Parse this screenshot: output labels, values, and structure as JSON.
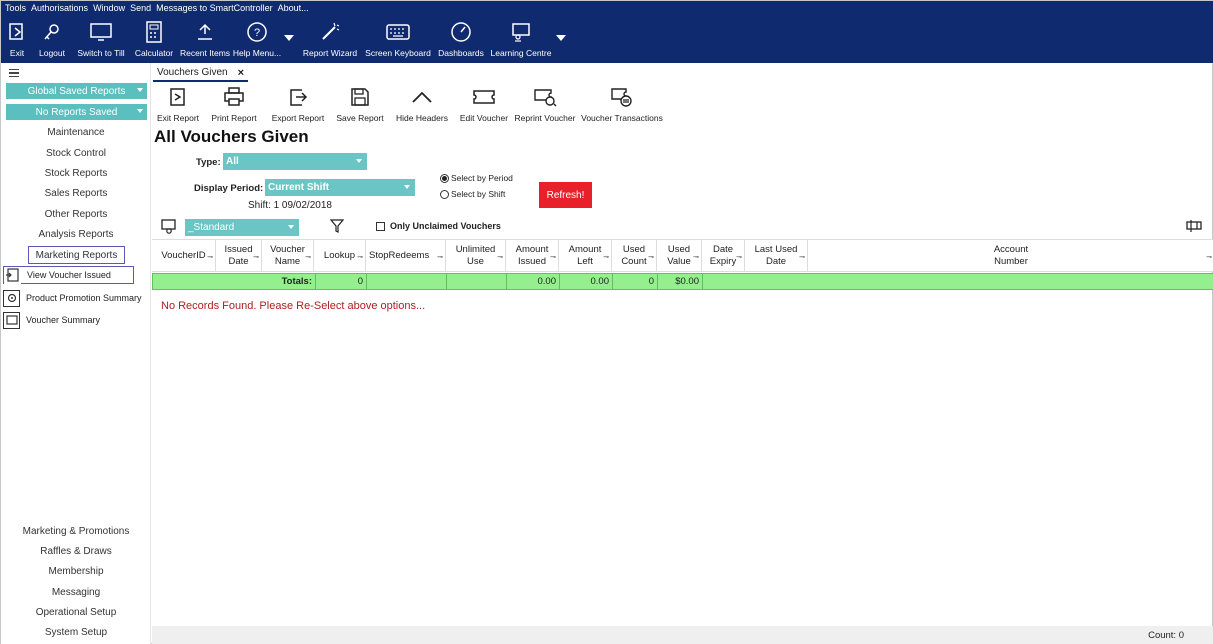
{
  "menu": [
    "Tools",
    "Authorisations",
    "Window",
    "Send",
    "Messages to SmartController",
    "About..."
  ],
  "toolbar": {
    "items": [
      {
        "label": "Exit",
        "icon": "exit-icon"
      },
      {
        "label": "Logout",
        "icon": "key-icon"
      },
      {
        "label": "Switch to Till",
        "icon": "monitor-icon"
      },
      {
        "label": "Calculator",
        "icon": "calculator-icon"
      },
      {
        "label": "Recent Items",
        "icon": "recent-items-icon"
      },
      {
        "label": "Help Menu...",
        "icon": "help-icon"
      },
      {
        "label": "Report Wizard",
        "icon": "wizard-icon"
      },
      {
        "label": "Screen Keyboard",
        "icon": "keyboard-icon"
      },
      {
        "label": "Dashboards",
        "icon": "gauge-icon"
      },
      {
        "label": "Learning Centre",
        "icon": "learning-icon"
      }
    ]
  },
  "sidebar": {
    "global_saved": "Global Saved Reports",
    "no_reports": "No Reports Saved",
    "items": [
      "Maintenance",
      "Stock Control",
      "Stock Reports",
      "Sales Reports",
      "Other Reports",
      "Analysis Reports"
    ],
    "selected_group": "Marketing Reports",
    "sub_items": [
      "View Voucher Issued",
      "Product Promotion Summary",
      "Voucher Summary"
    ],
    "bottom_items": [
      "Marketing & Promotions",
      "Raffles & Draws",
      "Membership",
      "Messaging",
      "Operational Setup",
      "System Setup"
    ]
  },
  "tab": {
    "label": "Vouchers Given",
    "close": "×"
  },
  "report_toolbar": [
    {
      "label": "Exit Report",
      "icon": "exit-report-icon"
    },
    {
      "label": "Print Report",
      "icon": "print-icon"
    },
    {
      "label": "Export Report",
      "icon": "export-icon"
    },
    {
      "label": "Save Report",
      "icon": "save-icon"
    },
    {
      "label": "Hide Headers",
      "icon": "chevron-up-icon"
    },
    {
      "label": "Edit Voucher",
      "icon": "ticket-icon"
    },
    {
      "label": "Reprint Voucher",
      "icon": "reprint-icon"
    },
    {
      "label": "Voucher Transactions",
      "icon": "transactions-icon"
    }
  ],
  "report": {
    "title": "All Vouchers Given",
    "type_label": "Type:",
    "type_value": "All",
    "period_label": "Display Period:",
    "period_value": "Current Shift",
    "shift_info": "Shift: 1 09/02/2018",
    "radio_period": "Select by Period",
    "radio_shift": "Select by Shift",
    "refresh": "Refresh!",
    "layout_value": "_Standard",
    "unclaimed_label": "Only Unclaimed Vouchers"
  },
  "grid": {
    "columns": [
      "VoucherID",
      "Issued Date",
      "Voucher Name",
      "Lookup",
      "StopRedeems",
      "Unlimited Use",
      "Amount Issued",
      "Amount Left",
      "Used Count",
      "Used Value",
      "Date Expiry",
      "Last Used Date",
      "Account Number"
    ],
    "totals_label": "Totals:",
    "totals": {
      "lookup": "0",
      "amount_issued": "0.00",
      "amount_left": "0.00",
      "used_count": "0",
      "used_value": "$0.00"
    },
    "no_records": "No Records Found. Please Re-Select above options..."
  },
  "status": {
    "count": "Count: 0"
  }
}
